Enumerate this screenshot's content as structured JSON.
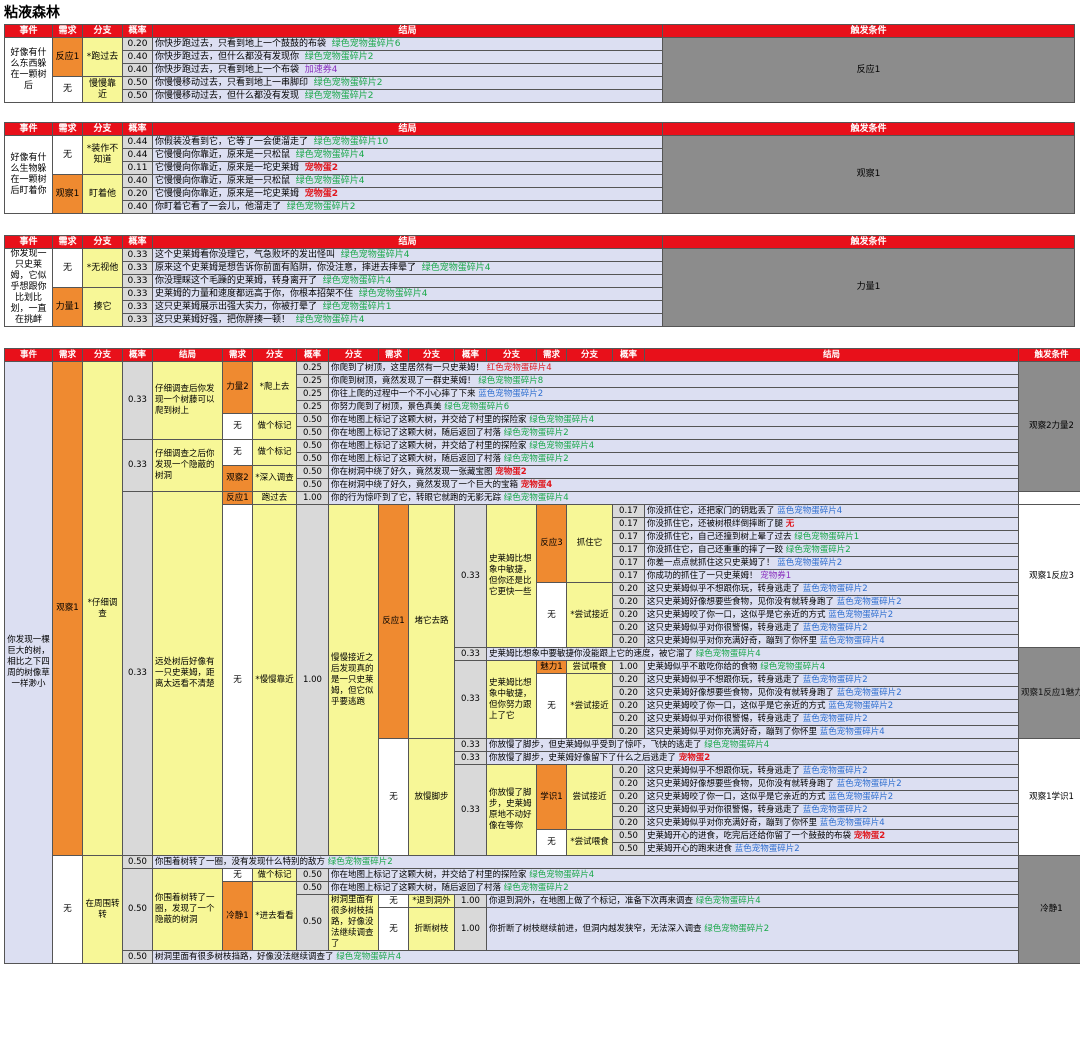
{
  "title": "粘液森林",
  "colors": {
    "header": "#e8101a",
    "lavender": "#dcdff2",
    "yellow": "#f7f797",
    "orange": "#ef8a30",
    "condition": "#8c8c8c"
  },
  "headers": {
    "event": "事件",
    "need": "需求",
    "branch": "分支",
    "prob": "概率",
    "result": "结局",
    "trigger": "触发条件"
  },
  "s1": {
    "event": "好像有什么东西躲在一颗树后",
    "need1": "反应1",
    "need2": "无",
    "b1": "*跑过去",
    "b2": "慢慢靠近",
    "rows": [
      {
        "p": "0.20",
        "t": "你快步跑过去，只看到地上一个鼓鼓的布袋",
        "r": "绿色宠物蛋碎片6"
      },
      {
        "p": "0.40",
        "t": "你快步跑过去，但什么都没有发现你",
        "r": "绿色宠物蛋碎片2"
      },
      {
        "p": "0.40",
        "t": "你快步跑过去，只看到地上一个布袋",
        "r": "加速券4"
      },
      {
        "p": "0.50",
        "t": "你慢慢移动过去，只看到地上一串脚印",
        "r": "绿色宠物蛋碎片2"
      },
      {
        "p": "0.50",
        "t": "你慢慢移动过去，但什么都没有发现",
        "r": "绿色宠物蛋碎片2"
      }
    ],
    "cond": "反应1"
  },
  "s2": {
    "event": "好像有什么生物躲在一颗树后盯着你",
    "need1": "无",
    "need2": "观察1",
    "b1": "*装作不知道",
    "b2": "盯着他",
    "rows": [
      {
        "p": "0.44",
        "t": "你假装没看到它，它等了一会便溜走了",
        "r": "绿色宠物蛋碎片10"
      },
      {
        "p": "0.44",
        "t": "它慢慢向你靠近，原来是一只松鼠",
        "r": "绿色宠物蛋碎片4"
      },
      {
        "p": "0.11",
        "t": "它慢慢向你靠近，原来是一坨史莱姆",
        "r": "宠物蛋2"
      },
      {
        "p": "0.40",
        "t": "它慢慢向你靠近，原来是一只松鼠",
        "r": "绿色宠物蛋碎片4"
      },
      {
        "p": "0.20",
        "t": "它慢慢向你靠近，原来是一坨史莱姆",
        "r": "宠物蛋2"
      },
      {
        "p": "0.40",
        "t": "你盯着它看了一会儿，他溜走了",
        "r": "绿色宠物蛋碎片2"
      }
    ],
    "cond": "观察1"
  },
  "s3": {
    "event": "你发现一只史莱姆，它似乎想跟你比划比划，一直在挑衅",
    "need1": "无",
    "need2": "力量1",
    "b1": "*无视他",
    "b2": "揍它",
    "rows": [
      {
        "p": "0.33",
        "t": "这个史莱姆看你没理它，气急败坏的发出怪叫",
        "r": "绿色宠物蛋碎片4"
      },
      {
        "p": "0.33",
        "t": "原来这个史莱姆是想告诉你前面有陷阱，你没注意，摔进去摔晕了",
        "r": "绿色宠物蛋碎片4"
      },
      {
        "p": "0.33",
        "t": "你没理睬这个毛躁的史莱姆，转身离开了",
        "r": "绿色宠物蛋碎片4"
      },
      {
        "p": "0.33",
        "t": "史莱姆的力量和速度都远高于你，你根本招架不住",
        "r": "绿色宠物蛋碎片4"
      },
      {
        "p": "0.33",
        "t": "这只史莱姆展示出强大实力，你被打晕了",
        "r": "绿色宠物蛋碎片1"
      },
      {
        "p": "0.33",
        "t": "这只史莱姆好强，把你胖揍一顿！",
        "r": "绿色宠物蛋碎片4"
      }
    ],
    "cond": "力量1"
  },
  "s4": {
    "event": "你发现一棵巨大的树，相比之下四周的树像草一样渺小",
    "need_a": "观察1",
    "branch_a": "*仔细调查",
    "need_b": "无",
    "branch_b": "在周围转转",
    "a1": {
      "p": "0.33",
      "desc": "仔细调查后你发现一个树藤可以爬到树上",
      "need": "力量2",
      "branch": "*爬上去",
      "need2": "无",
      "branch2": "做个标记",
      "rows": [
        {
          "p": "0.25",
          "t": "你爬到了树顶，这里居然有一只史莱姆！",
          "r": "红色宠物蛋碎片4"
        },
        {
          "p": "0.25",
          "t": "你爬到树顶，竟然发现了一群史莱姆！",
          "r": "绿色宠物蛋碎片8"
        },
        {
          "p": "0.25",
          "t": "你往上爬的过程中一个不小心摔了下来",
          "r": "蓝色宠物蛋碎片2"
        },
        {
          "p": "0.25",
          "t": "你努力爬到了树顶，景色真美",
          "r": "绿色宠物蛋碎片6"
        },
        {
          "p": "0.50",
          "t": "你在地图上标记了这颗大树，并交给了村里的探险家",
          "r": "绿色宠物蛋碎片4"
        },
        {
          "p": "0.50",
          "t": "你在地图上标记了这颗大树，随后返回了村落",
          "r": "绿色宠物蛋碎片2"
        }
      ]
    },
    "a2": {
      "p": "0.33",
      "desc": "仔细调查之后你发现一个隐蔽的树洞",
      "need": "无",
      "branch": "做个标记",
      "need2": "观察2",
      "branch2": "*深入调查",
      "rows": [
        {
          "p": "0.50",
          "t": "你在地图上标记了这颗大树，并交给了村里的探险家",
          "r": "绿色宠物蛋碎片4"
        },
        {
          "p": "0.50",
          "t": "你在地图上标记了这颗大树，随后返回了村落",
          "r": "绿色宠物蛋碎片2"
        },
        {
          "p": "0.50",
          "t": "你在树洞中绕了好久，竟然发现一张藏宝图",
          "r": "宠物蛋2"
        },
        {
          "p": "0.50",
          "t": "你在树洞中绕了好久，竟然发现了一个巨大的宝箱",
          "r": "宠物蛋4"
        }
      ]
    },
    "cond_a": "观察2力量2",
    "a3": {
      "p": "0.33",
      "desc": "远处树后好像有一只史莱姆，距离太远看不清楚",
      "need": "反应1",
      "branch": "跑过去",
      "run": {
        "p": "1.00",
        "t": "你的行为惊吓到了它，转眼它就跑的无影无踪",
        "r": "绿色宠物蛋碎片4"
      },
      "need2": "无",
      "branch2": "*慢慢靠近",
      "p2": "1.00",
      "desc2": "慢慢接近之后发现真的是一只史莱姆，但它似乎要逃跑",
      "block_need": "反应1",
      "block_branch": "堵它去路",
      "b1": {
        "p": "0.33",
        "desc": "史莱姆比想象中敏捷，但你还是比它更快一些",
        "need": "反应3",
        "branch": "抓住它",
        "need2": "无",
        "branch2": "*尝试接近",
        "rows": [
          {
            "p": "0.17",
            "t": "你没抓住它，还把家门的钥匙丢了",
            "r": "蓝色宠物蛋碎片4"
          },
          {
            "p": "0.17",
            "t": "你没抓住它，还被树根绊倒摔断了腿",
            "r": "无"
          },
          {
            "p": "0.17",
            "t": "你没抓住它，自己还撞到树上晕了过去",
            "r": "绿色宠物蛋碎片1"
          },
          {
            "p": "0.17",
            "t": "你没抓住它，自己还重重的摔了一跤",
            "r": "绿色宠物蛋碎片2"
          },
          {
            "p": "0.17",
            "t": "你差一点点就抓住这只史莱姆了！",
            "r": "蓝色宠物蛋碎片2"
          },
          {
            "p": "0.17",
            "t": "你成功的抓住了一只史莱姆！",
            "r": "宠物券1"
          },
          {
            "p": "0.20",
            "t": "这只史莱姆似乎不想跟你玩，转身逃走了",
            "r": "蓝色宠物蛋碎片2"
          },
          {
            "p": "0.20",
            "t": "这只史莱姆好像想要些食物，见你没有就转身跑了",
            "r": "蓝色宠物蛋碎片2"
          },
          {
            "p": "0.20",
            "t": "这只史莱姆咬了你一口，这似乎是它亲近的方式",
            "r": "蓝色宠物蛋碎片2"
          },
          {
            "p": "0.20",
            "t": "这只史莱姆似乎对你很警惕，转身逃走了",
            "r": "蓝色宠物蛋碎片2"
          },
          {
            "p": "0.20",
            "t": "这只史莱姆似乎对你充满好奇，蹦到了你怀里",
            "r": "蓝色宠物蛋碎片4"
          }
        ]
      },
      "b_mid": {
        "p": "0.33",
        "t": "史莱姆比想象中要敏捷你没能跟上它的速度，被它溜了",
        "r": "绿色宠物蛋碎片4"
      },
      "b2": {
        "p": "0.33",
        "desc": "史莱姆比想象中敏捷，但你努力跟上了它",
        "need": "魅力1",
        "branch": "尝试喂食",
        "need2": "无",
        "branch2": "*尝试接近",
        "rows": [
          {
            "p": "1.00",
            "t": "史莱姆似乎不敢吃你给的食物",
            "r": "绿色宠物蛋碎片4"
          },
          {
            "p": "0.20",
            "t": "这只史莱姆似乎不想跟你玩，转身逃走了",
            "r": "蓝色宠物蛋碎片2"
          },
          {
            "p": "0.20",
            "t": "这只史莱姆好像想要些食物，见你没有就转身跑了",
            "r": "蓝色宠物蛋碎片2"
          },
          {
            "p": "0.20",
            "t": "这只史莱姆咬了你一口，这似乎是它亲近的方式",
            "r": "蓝色宠物蛋碎片2"
          },
          {
            "p": "0.20",
            "t": "这只史莱姆似乎对你很警惕，转身逃走了",
            "r": "蓝色宠物蛋碎片2"
          },
          {
            "p": "0.20",
            "t": "这只史莱姆似乎对你充满好奇，蹦到了你怀里",
            "r": "蓝色宠物蛋碎片4"
          }
        ]
      },
      "slow_need": "无",
      "slow_branch": "放慢脚步",
      "c1": {
        "p": "0.33",
        "t": "你放慢了脚步，但史莱姆似乎受到了惊吓，飞快的逃走了",
        "r": "绿色宠物蛋碎片4"
      },
      "c2": {
        "p": "0.33",
        "t": "你放慢了脚步，史莱姆好像留下了什么之后逃走了",
        "r": "宠物蛋2"
      },
      "c3": {
        "p": "0.33",
        "desc": "你放慢了脚步，史莱姆原地不动好像在等你",
        "need": "学识1",
        "branch": "尝试接近",
        "need2": "无",
        "branch2": "*尝试喂食",
        "rows": [
          {
            "p": "0.20",
            "t": "这只史莱姆似乎不想跟你玩，转身逃走了",
            "r": "蓝色宠物蛋碎片2"
          },
          {
            "p": "0.20",
            "t": "这只史莱姆好像想要些食物，见你没有就转身跑了",
            "r": "蓝色宠物蛋碎片2"
          },
          {
            "p": "0.20",
            "t": "这只史莱姆咬了你一口，这似乎是它亲近的方式",
            "r": "蓝色宠物蛋碎片2"
          },
          {
            "p": "0.20",
            "t": "这只史莱姆似乎对你很警惕，转身逃走了",
            "r": "蓝色宠物蛋碎片2"
          },
          {
            "p": "0.20",
            "t": "这只史莱姆似乎对你充满好奇，蹦到了你怀里",
            "r": "蓝色宠物蛋碎片4"
          },
          {
            "p": "0.50",
            "t": "史莱姆开心的进食，吃完后还给你留了一个鼓鼓的布袋",
            "r": "宠物蛋2"
          },
          {
            "p": "0.50",
            "t": "史莱姆开心的跑来进食",
            "r": "蓝色宠物蛋碎片2"
          }
        ]
      }
    },
    "cond_b1": "观察1反应3",
    "cond_b2": "观察1反应1魅力1",
    "cond_b3": "观察1学识1",
    "d0": {
      "p": "0.50",
      "t": "你围着树转了一圈，没有发现什么特别的敌方",
      "r": "绿色宠物蛋碎片2"
    },
    "d1": {
      "p": "0.50",
      "desc": "你围着树转了一圈，发现了一个隐蔽的树洞",
      "need": "无",
      "branch": "做个标记",
      "rows": [
        {
          "p": "0.50",
          "t": "你在地图上标记了这颗大树，并交给了村里的探险家",
          "r": "绿色宠物蛋碎片4"
        },
        {
          "p": "0.50",
          "t": "你在地图上标记了这颗大树，随后返回了村落",
          "r": "绿色宠物蛋碎片2"
        }
      ],
      "need2": "冷静1",
      "branch2": "*进去看看",
      "p2": "0.50",
      "desc2": "树洞里面有很多树枝挡路，好像没法继续调查了",
      "o1": {
        "need": "无",
        "branch": "*退到洞外",
        "p": "1.00",
        "t": "你退到洞外，在地图上做了个标记，准备下次再来调查",
        "r": "绿色宠物蛋碎片4"
      },
      "o2": {
        "need": "无",
        "branch": "折断树枝",
        "p": "1.00",
        "t": "你折断了树枝继续前进，但洞内越发狭窄，无法深入调查",
        "r": "绿色宠物蛋碎片2"
      }
    },
    "d2": {
      "p": "0.50",
      "t": "树洞里面有很多树枝挡路，好像没法继续调查了",
      "r": "绿色宠物蛋碎片4"
    },
    "cond_d": "冷静1"
  },
  "extra_headers": [
    "需求",
    "分支",
    "概率",
    "分支",
    "需求",
    "分支",
    "概率",
    "分支",
    "需求",
    "分支",
    "概率",
    "结局"
  ]
}
